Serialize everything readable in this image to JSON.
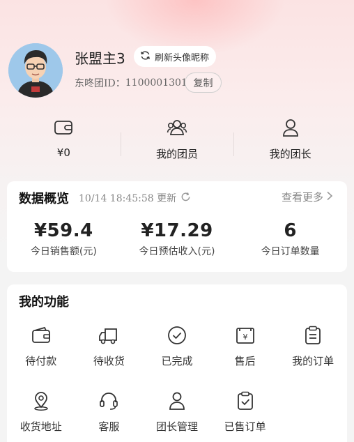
{
  "profile": {
    "username": "张盟主3",
    "refresh_label": "刷新头像昵称",
    "id_prefix": "东咚团ID：",
    "id_value": "1100001301",
    "copy_label": "复制"
  },
  "stats": [
    {
      "icon": "wallet-icon",
      "label": "¥0"
    },
    {
      "icon": "members-icon",
      "label": "我的团员"
    },
    {
      "icon": "leader-icon",
      "label": "我的团长"
    }
  ],
  "overview": {
    "title": "数据概览",
    "update_time": "10/14 18:45:58 更新",
    "see_more": "查看更多",
    "metrics": [
      {
        "value": "¥59.4",
        "caption": "今日销售额(元)"
      },
      {
        "value": "¥17.29",
        "caption": "今日预估收入(元)"
      },
      {
        "value": "6",
        "caption": "今日订单数量"
      }
    ]
  },
  "functions": {
    "title": "我的功能",
    "items": [
      {
        "icon": "pending-payment-icon",
        "label": "待付款"
      },
      {
        "icon": "delivery-truck-icon",
        "label": "待收货"
      },
      {
        "icon": "check-circle-icon",
        "label": "已完成"
      },
      {
        "icon": "after-sale-icon",
        "label": "售后"
      },
      {
        "icon": "order-clipboard-icon",
        "label": "我的订单"
      },
      {
        "icon": "location-pin-icon",
        "label": "收货地址"
      },
      {
        "icon": "headset-icon",
        "label": "客服"
      },
      {
        "icon": "leader-manage-icon",
        "label": "团长管理"
      },
      {
        "icon": "sold-order-icon",
        "label": "已售订单"
      }
    ]
  },
  "colors": {
    "header_gradient_top": "#fbe3e3",
    "background": "#f4f4f4",
    "card": "#ffffff",
    "text_primary": "#222222",
    "text_secondary": "#888888"
  }
}
